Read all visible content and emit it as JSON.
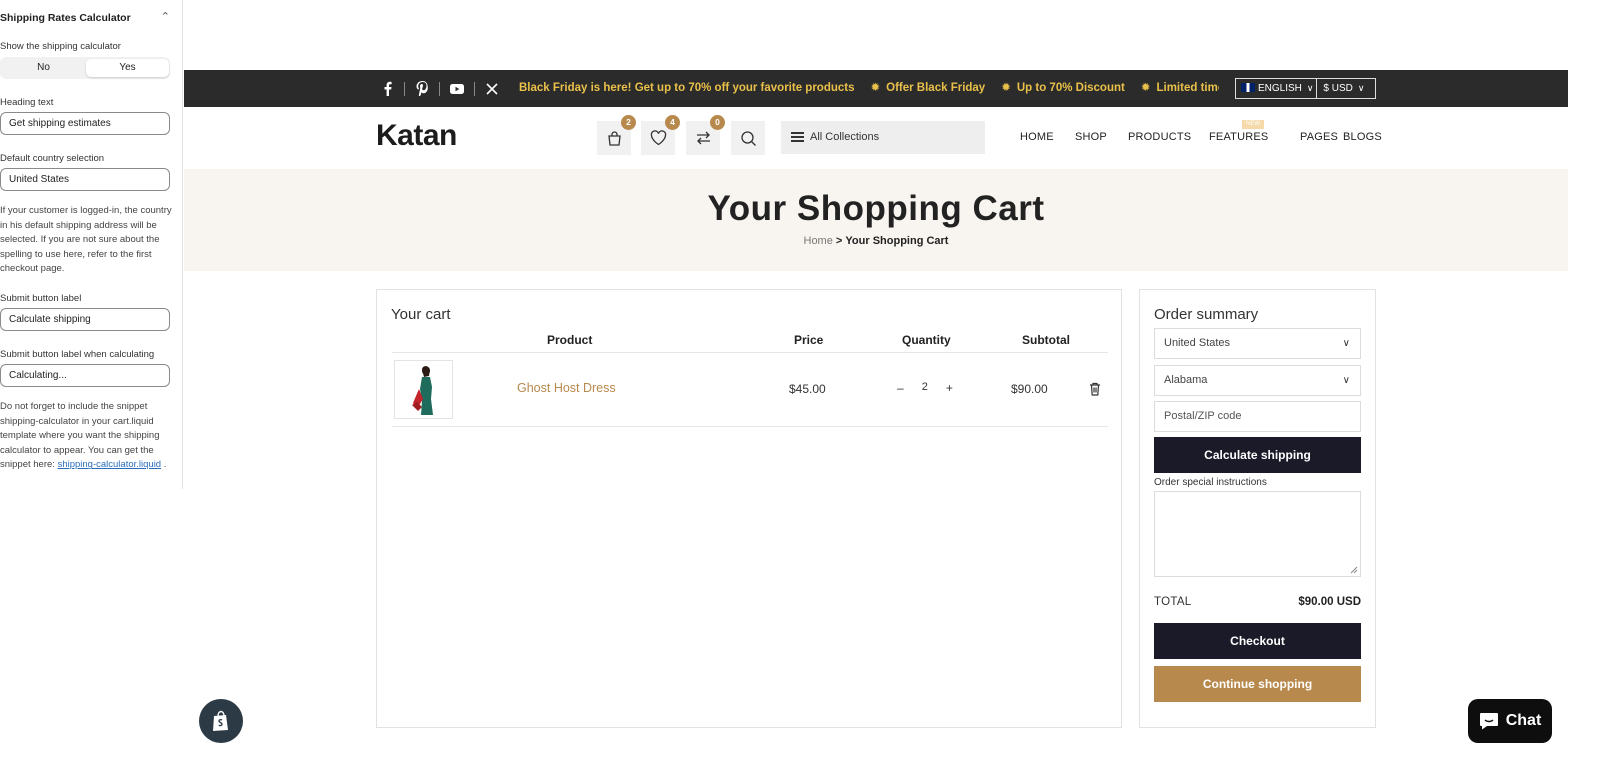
{
  "panel": {
    "title": "Shipping Rates Calculator",
    "show_label": "Show the shipping calculator",
    "options": [
      "No",
      "Yes"
    ],
    "selected": "Yes",
    "heading_label": "Heading text",
    "heading_value": "Get shipping estimates",
    "country_label": "Default country selection",
    "country_value": "United States",
    "country_help": "If your customer is logged-in, the country in his default shipping address will be selected. If you are not sure about the spelling to use here, refer to the first checkout page.",
    "submit_label": "Submit button label",
    "submit_value": "Calculate shipping",
    "calculating_label": "Submit button label when calculating",
    "calculating_value": "Calculating...",
    "snippet_help": "Do not forget to include the snippet shipping-calculator in your cart.liquid template where you want the shipping calculator to appear. You can get the snippet here:",
    "snippet_link": "shipping-calculator.liquid",
    "snippet_tail": "."
  },
  "topbar": {
    "social_icons": [
      "facebook-icon",
      "pinterest-icon",
      "youtube-icon",
      "x-icon"
    ],
    "promo": [
      "Black Friday is here! Get up to 70% off your favorite products",
      "Offer Black Friday",
      "Up to 70% Discount",
      "Limited time offer"
    ],
    "language": "ENGLISH",
    "currency": "$ USD",
    "accent": "#e9c04a"
  },
  "header": {
    "logo": "Katan",
    "cart_count": "2",
    "wishlist_count": "4",
    "compare_count": "0",
    "collections": "All Collections",
    "nav": [
      "HOME",
      "SHOP",
      "PRODUCTS",
      "FEATURES",
      "PAGES",
      "BLOGS"
    ],
    "features_tag": "NEW"
  },
  "banner": {
    "title": "Your Shopping Cart",
    "crumb_home": "Home",
    "crumb_sep": ">",
    "crumb_current": "Your Shopping Cart"
  },
  "cart": {
    "title": "Your cart",
    "columns": [
      "Product",
      "Price",
      "Quantity",
      "Subtotal"
    ],
    "items": [
      {
        "name": "Ghost Host Dress",
        "price": "$45.00",
        "qty": "2",
        "subtotal": "$90.00"
      }
    ]
  },
  "summary": {
    "title": "Order summary",
    "country": "United States",
    "state": "Alabama",
    "zip_placeholder": "Postal/ZIP code",
    "calc_button": "Calculate shipping",
    "instructions_label": "Order special instructions",
    "total_label": "TOTAL",
    "total_value": "$90.00 USD",
    "checkout": "Checkout",
    "continue": "Continue shopping",
    "brand_gold": "#b8894d",
    "brand_dark": "#1a1a28"
  },
  "chat": {
    "label": "Chat"
  }
}
